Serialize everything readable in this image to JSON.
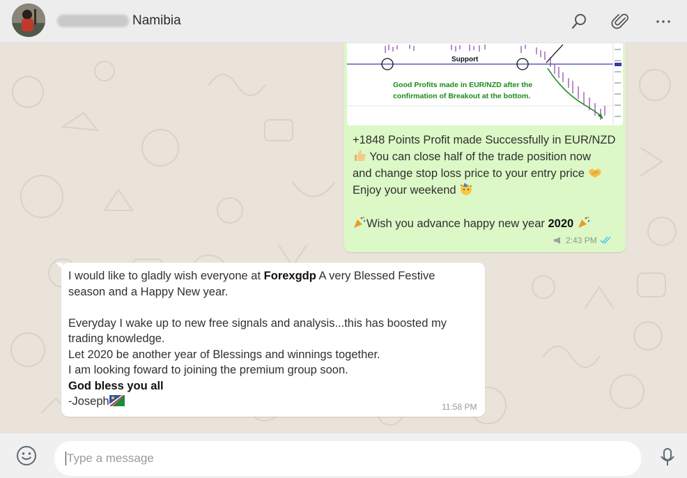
{
  "header": {
    "contact_name": "Namibia",
    "icons": [
      "search-icon",
      "attach-icon",
      "menu-icon"
    ]
  },
  "outgoing": {
    "chart_support_label": "Support",
    "chart_caption_1": "Good Profits made in EUR/NZD after the",
    "chart_caption_2": "confirmation of Breakout at the bottom.",
    "line1": "+1848 Points Profit made Successfully in EUR/NZD",
    "line2": "You can close half of the trade position now",
    "line3": "and change stop loss price to your entry price",
    "line4": "Enjoy your weekend",
    "line5_a": "Wish you advance happy new year ",
    "line5_b": "2020",
    "time": "2:43 PM"
  },
  "incoming": {
    "p1_a": "I would like to gladly wish everyone at ",
    "p1_b": "Forexgdp",
    "p1_c": " A very Blessed Festive",
    "p1_d": "season and a Happy New year.",
    "p2": "Everyday I wake up to new free signals and analysis...this has boosted my",
    "p3": "trading knowledge.",
    "p4": "Let 2020 be another year of Blessings and winnings together.",
    "p5": "I am looking foward to joining the premium group soon.",
    "p6": "God bless you all",
    "p7": "-Joseph",
    "time": "11:58 PM"
  },
  "composer": {
    "placeholder": "Type a message"
  },
  "colors": {
    "outgoing_bubble": "#dcf8c6",
    "incoming_bubble": "#ffffff",
    "read_ticks": "#4fc3f7",
    "chart_caption": "#1a8a1a"
  }
}
